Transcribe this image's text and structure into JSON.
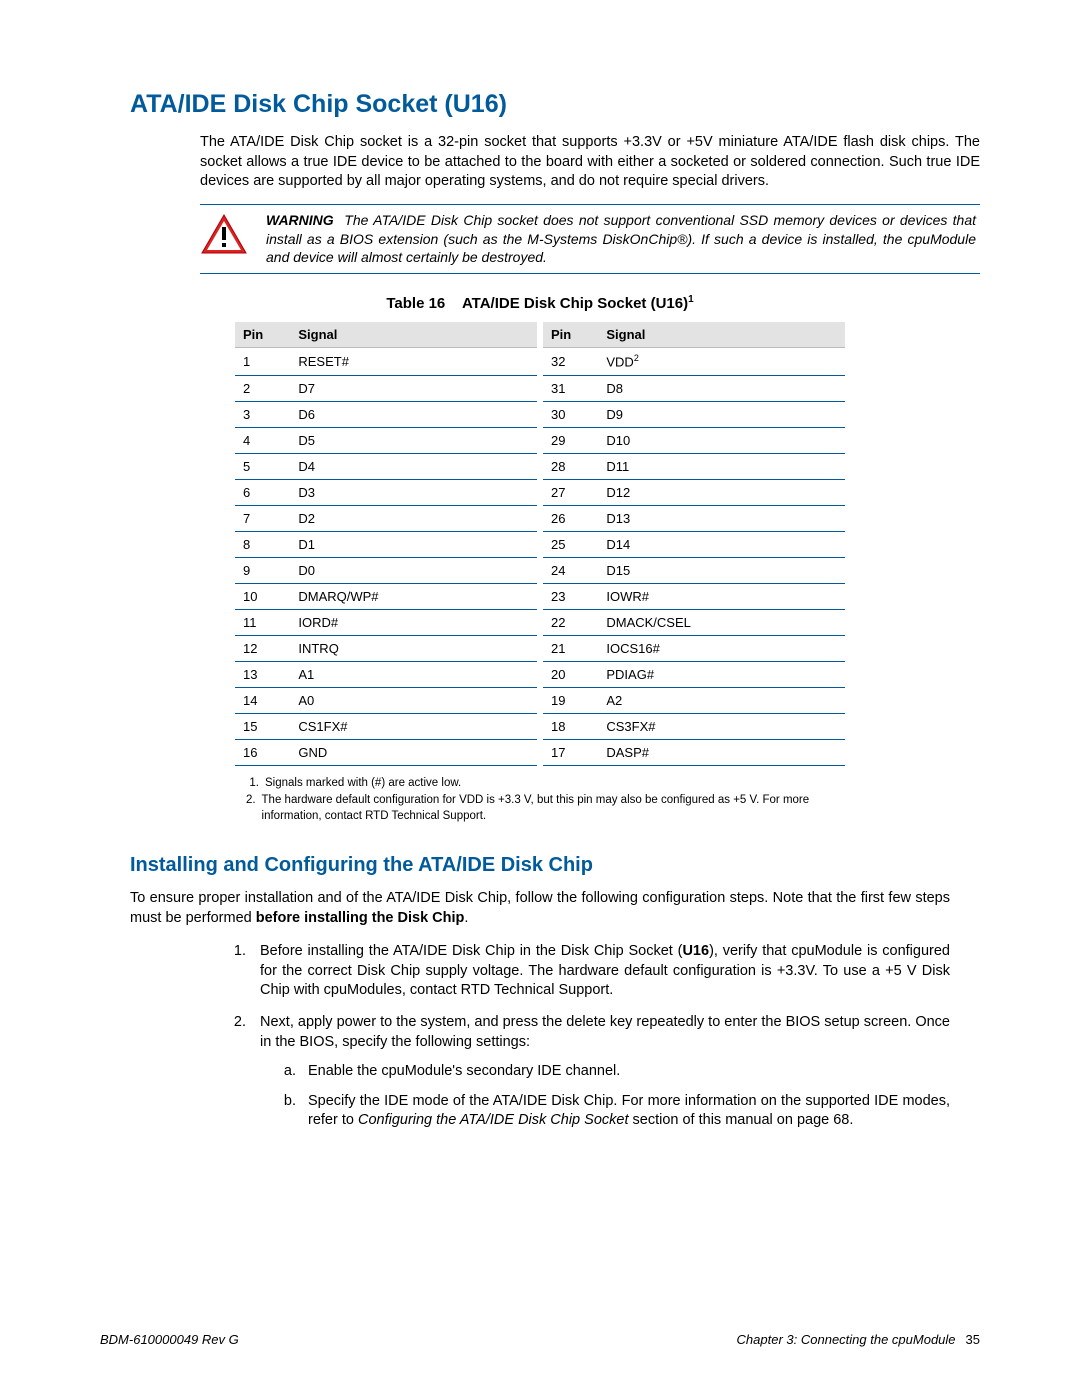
{
  "heading": "ATA/IDE Disk Chip Socket (U16)",
  "intro": "The ATA/IDE Disk Chip socket is a 32-pin socket that supports +3.3V or +5V miniature ATA/IDE flash disk chips. The socket allows a true IDE device to be attached to the board with either a socketed or soldered connection. Such true IDE devices are supported by all major operating systems, and do not require special drivers.",
  "warning": {
    "label": "WARNING",
    "text": "The ATA/IDE Disk Chip socket does not support conventional SSD memory devices or devices that install as a BIOS extension (such as the M-Systems DiskOnChip®). If such a device is installed, the cpuModule and device will almost certainly be destroyed."
  },
  "table": {
    "caption_prefix": "Table 16",
    "caption": "ATA/IDE Disk Chip Socket (U16)",
    "headers": {
      "pin": "Pin",
      "signal": "Signal"
    },
    "rows": [
      {
        "lp": "1",
        "ls": "RESET#",
        "rp": "32",
        "rs": "VDD",
        "rs_sup": "2"
      },
      {
        "lp": "2",
        "ls": "D7",
        "rp": "31",
        "rs": "D8"
      },
      {
        "lp": "3",
        "ls": "D6",
        "rp": "30",
        "rs": "D9"
      },
      {
        "lp": "4",
        "ls": "D5",
        "rp": "29",
        "rs": "D10"
      },
      {
        "lp": "5",
        "ls": "D4",
        "rp": "28",
        "rs": "D11"
      },
      {
        "lp": "6",
        "ls": "D3",
        "rp": "27",
        "rs": "D12"
      },
      {
        "lp": "7",
        "ls": "D2",
        "rp": "26",
        "rs": "D13"
      },
      {
        "lp": "8",
        "ls": "D1",
        "rp": "25",
        "rs": "D14"
      },
      {
        "lp": "9",
        "ls": "D0",
        "rp": "24",
        "rs": "D15"
      },
      {
        "lp": "10",
        "ls": "DMARQ/WP#",
        "rp": "23",
        "rs": "IOWR#"
      },
      {
        "lp": "11",
        "ls": "IORD#",
        "rp": "22",
        "rs": "DMACK/CSEL"
      },
      {
        "lp": "12",
        "ls": "INTRQ",
        "rp": "21",
        "rs": "IOCS16#"
      },
      {
        "lp": "13",
        "ls": "A1",
        "rp": "20",
        "rs": "PDIAG#"
      },
      {
        "lp": "14",
        "ls": "A0",
        "rp": "19",
        "rs": "A2"
      },
      {
        "lp": "15",
        "ls": "CS1FX#",
        "rp": "18",
        "rs": "CS3FX#"
      },
      {
        "lp": "16",
        "ls": "GND",
        "rp": "17",
        "rs": "DASP#"
      }
    ]
  },
  "notes": {
    "n1": "Signals marked with (#) are active low.",
    "n2": "The hardware default configuration for VDD is +3.3 V, but this pin may also be configured as +5 V. For more information, contact RTD Technical Support."
  },
  "sub_heading": "Installing and Configuring the ATA/IDE Disk Chip",
  "body1_a": "To ensure proper installation and of the ATA/IDE Disk Chip, follow the following configuration steps. Note that the first few steps must be performed ",
  "body1_b": "before installing the Disk Chip",
  "body1_c": ".",
  "steps": {
    "s1_a": "Before installing the ATA/IDE Disk Chip in the Disk Chip Socket (",
    "s1_b": "U16",
    "s1_c": "), verify that cpuModule is configured for the correct Disk Chip supply voltage. The hardware default configuration is +3.3V. To use a +5 V Disk Chip with cpuModules, contact RTD Technical Support.",
    "s2": "Next, apply power to the system, and press the delete key repeatedly to enter the BIOS setup screen. Once in the BIOS, specify the following settings:",
    "s2a": "Enable the cpuModule's secondary IDE channel.",
    "s2b_a": "Specify the IDE mode of the ATA/IDE Disk Chip. For more information on the supported IDE modes, refer to ",
    "s2b_b": "Configuring the ATA/IDE Disk Chip Socket",
    "s2b_c": " section of this manual on page 68."
  },
  "footer": {
    "left": "BDM-610000049    Rev G",
    "right_chapter": "Chapter 3:  Connecting the cpuModule",
    "right_page": "35"
  }
}
